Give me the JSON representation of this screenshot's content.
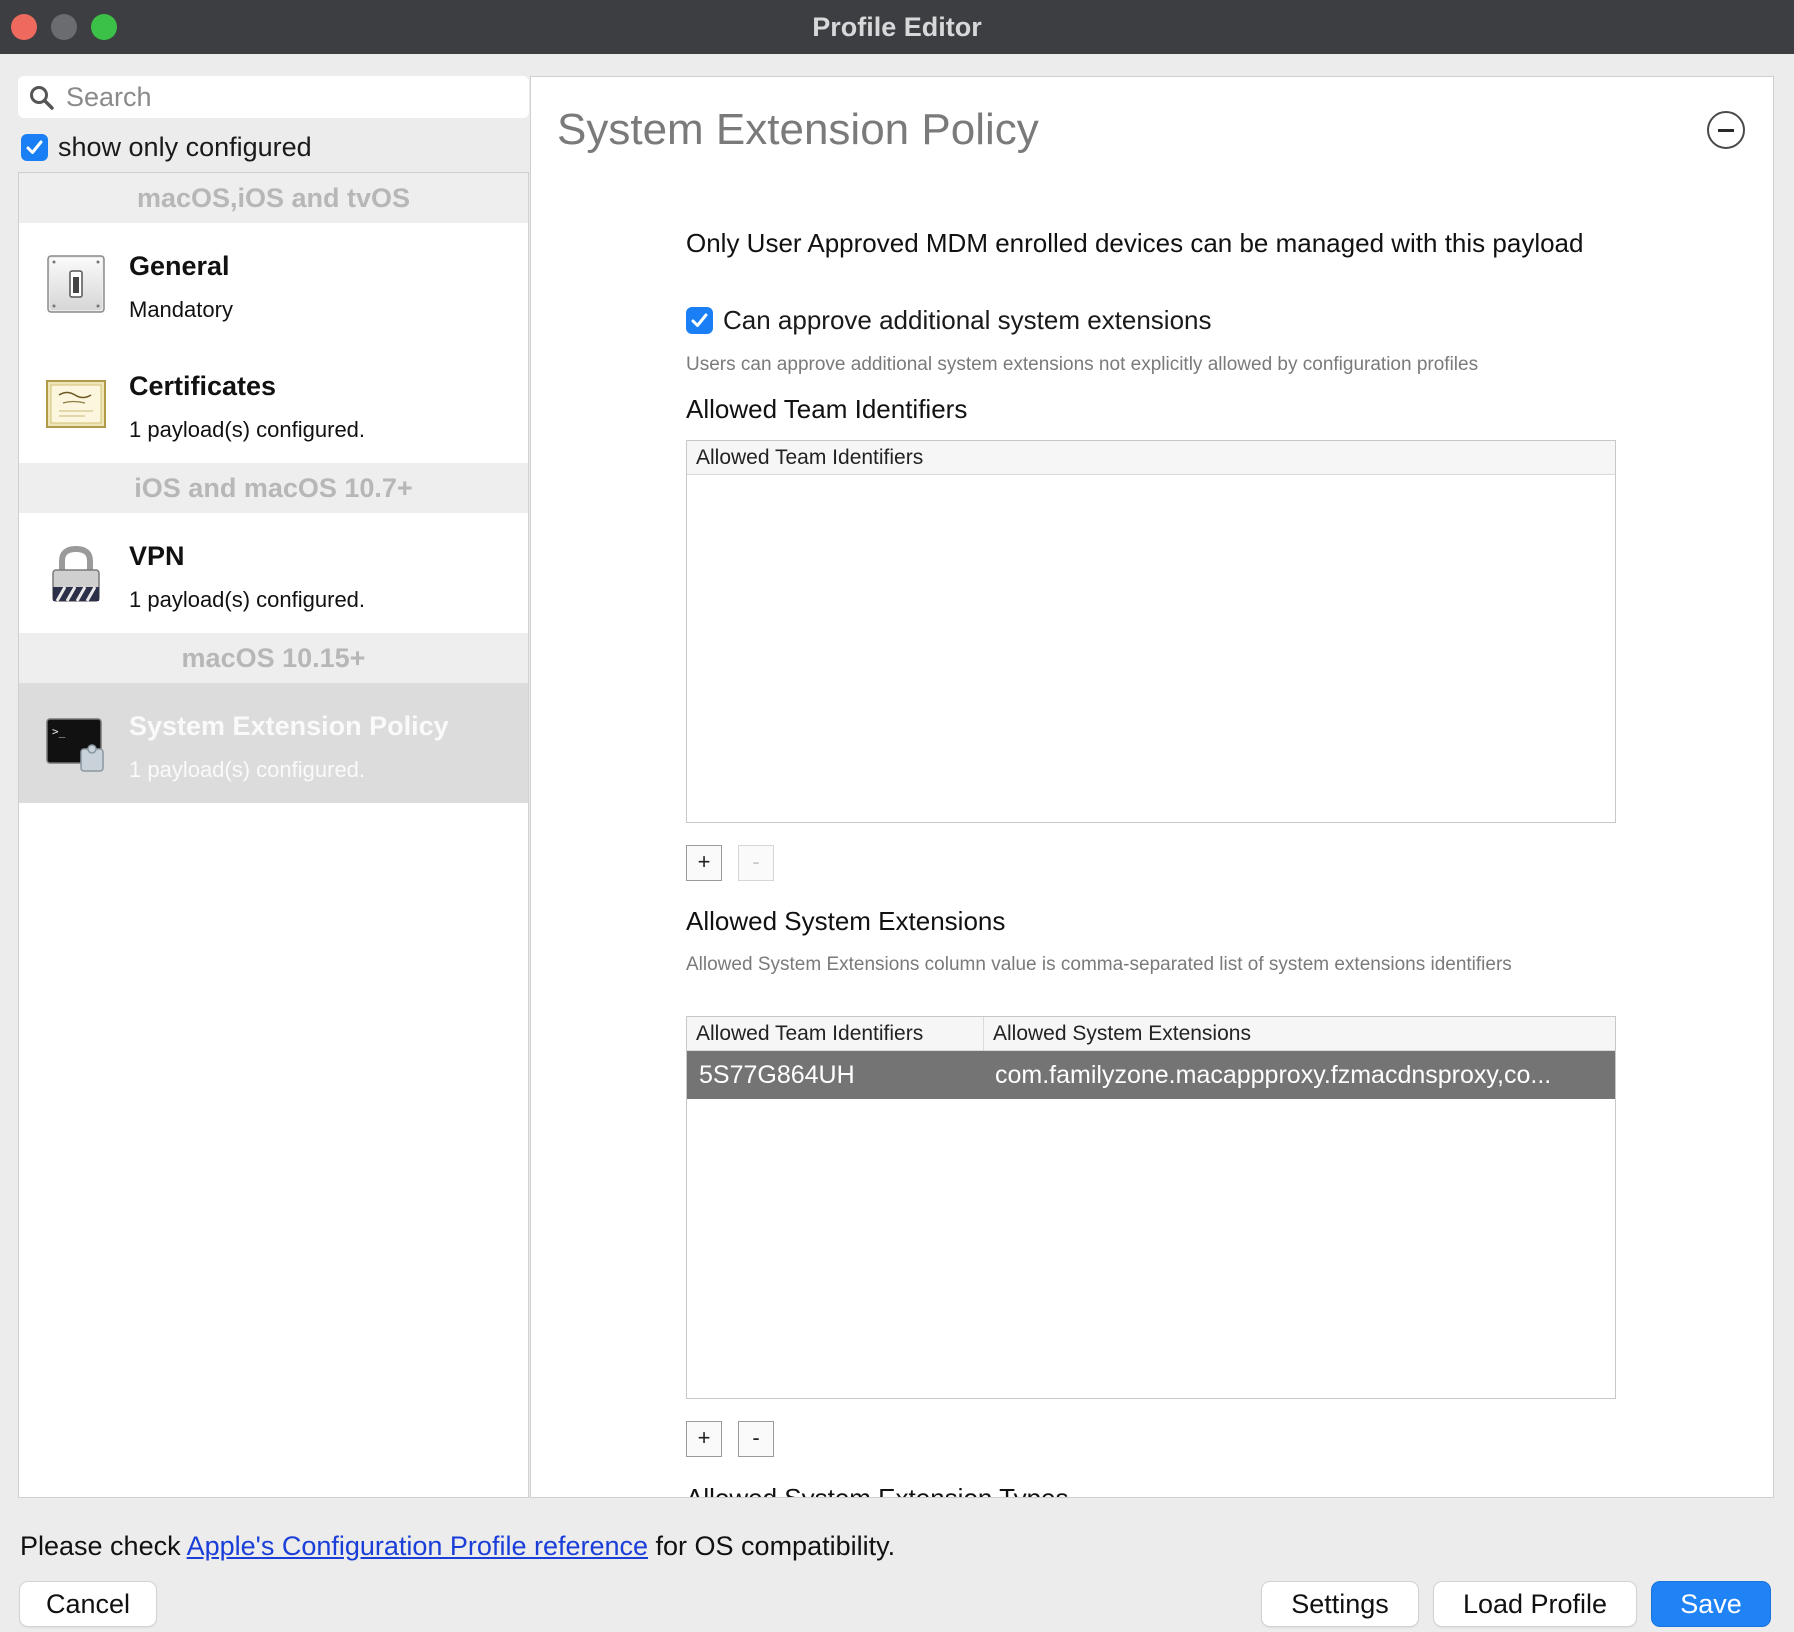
{
  "window": {
    "title": "Profile Editor"
  },
  "sidebar": {
    "search_placeholder": "Search",
    "show_only_configured": {
      "label": "show only configured",
      "checked": true
    },
    "sections": [
      {
        "header": "macOS,iOS and tvOS",
        "items": [
          {
            "title": "General",
            "subtitle": "Mandatory",
            "icon": "switch-icon"
          },
          {
            "title": "Certificates",
            "subtitle": "1 payload(s) configured.",
            "icon": "certificate-icon"
          }
        ]
      },
      {
        "header": "iOS and macOS 10.7+",
        "items": [
          {
            "title": "VPN",
            "subtitle": "1 payload(s) configured.",
            "icon": "vpn-lock-icon"
          }
        ]
      },
      {
        "header": "macOS 10.15+",
        "items": [
          {
            "title": "System Extension Policy",
            "subtitle": "1 payload(s) configured.",
            "icon": "terminal-extension-icon",
            "selected": true
          }
        ]
      }
    ]
  },
  "main": {
    "title": "System Extension Policy",
    "note": "Only User Approved MDM enrolled devices can be managed with this payload",
    "approve_checkbox": {
      "label": "Can approve additional system extensions",
      "checked": true
    },
    "approve_help": "Users can approve additional system extensions not explicitly allowed by configuration profiles",
    "team_ids": {
      "label": "Allowed Team Identifiers",
      "column": "Allowed Team Identifiers",
      "rows": []
    },
    "sys_ext": {
      "label": "Allowed System Extensions",
      "help": "Allowed System Extensions column value is comma-separated list of system extensions identifiers",
      "columns": [
        "Allowed Team Identifiers",
        "Allowed System Extensions"
      ],
      "rows": [
        {
          "team": "5S77G864UH",
          "extensions": "com.familyzone.macappproxy.fzmacdnsproxy,co..."
        }
      ]
    },
    "plus": "+",
    "minus": "-",
    "next_section_label": "Allowed System Extension Types"
  },
  "footer": {
    "prefix": "Please check ",
    "link": "Apple's Configuration Profile reference",
    "suffix": " for OS compatibility.",
    "buttons": {
      "cancel": "Cancel",
      "settings": "Settings",
      "load": "Load Profile",
      "save": "Save"
    }
  },
  "colors": {
    "accent": "#1f83f6",
    "selected_row": "#747474",
    "link": "#1a3ed8"
  }
}
